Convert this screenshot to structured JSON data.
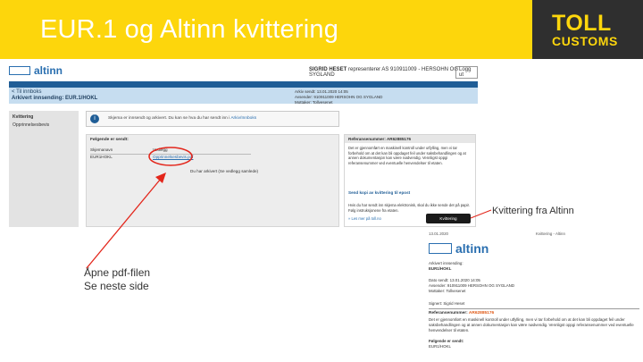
{
  "slide": {
    "title": "EUR.1 og Altinn kvittering",
    "logo_line1": "TOLL",
    "logo_line2": "CUSTOMS",
    "caption_right": "Kvittering fra Altinn",
    "caption_left_line1": "Åpne pdf-filen",
    "caption_left_line2": "Se neste side",
    "colors": {
      "header_bg": "#fdd60c",
      "logo_bg": "#2f2f2f",
      "altinn_blue": "#1f5d96",
      "callout": "#e3261b"
    }
  },
  "altinn": {
    "brand": "altinn",
    "user_label": "SIGRID HESET",
    "user_prefix": "representerer",
    "user_org": "AS 910911009 - HERSOHN OG SYGLAND",
    "logout_label": "Logg ut",
    "back_label": "< Til innboks",
    "message_title": "Arkivert innsending: EUR.1/HOKL",
    "meta_line1": "Arkiv sendt: 13.01.2020 14:05",
    "meta_line2": "Avsender: 910911009 HERSOHN OG SYGLAND",
    "meta_line3": "Mottaker: Tollvesenet",
    "sidebar_items": [
      "Kvittering",
      "Opprinnelsesbevis"
    ],
    "info_text": "Skjema er innsendt og arkivert. Du kan se hva du har sendt inn i",
    "info_link": "Arkiv/Innboks",
    "attachments_heading": "Følgende er sendt:",
    "attachments_header": [
      "Skjemanavn",
      "Vedlegg"
    ],
    "attachment_rows": [
      {
        "name": "EUR1HOKL",
        "file": "Opprinnelsesbevis.pdf"
      }
    ],
    "attachment_note": "Du har arkivert (Se vedlegg samlede)",
    "receipt_heading": "Referansenummer: AR62885176",
    "receipt_text": "Det er gjennomført en maskinell kontroll under utfylling, men vi tar forbehold om at det kan bli oppdaget feil under saksbehandlingen og at annen dokumentasjon kan være nødvendig. Vennligst oppgi referansenummer ved eventuelle henvendelser til etaten.",
    "receipt_link": "Send kopi av kvittering til epost",
    "receipt_text2": "Hvis du har sendt inn skjema elektronisk, skal du ikke sende det på papir. Følg instruksjonene fra etaten.",
    "receipt_link2": "» Les mer på toll.no",
    "kvittering_button": "Kvittering"
  },
  "pdf": {
    "date": "13.01.2020",
    "top_right": "Kvittering - Altinn",
    "brand": "altinn",
    "archived_label": "Arkivert innsending:",
    "archived_value": "EUR1/HOKL",
    "line_date": "Dato sendt: 13.01.2020 14:05",
    "line_sender": "Avsender: 910911009 HERSOHN OG SYGLAND",
    "line_receiver": "Mottaker: Tollvesenet",
    "line_sign": "Signert: Sigrid Heset",
    "ref_label": "Referansenummer:",
    "ref_value": "AR62885176",
    "ref_text": "Det er gjennomført en maskinell kontroll under utfylling, men vi tar forbehold om at det kan bli oppdaget feil under saksbehandlingen og at annen dokumentasjon kan være nødvendig. Vennligst oppgi referansenummer ved eventuelle henvendelser til etaten.",
    "sent_label": "Følgende er sendt:",
    "sent_value": "EUR1/HOKL"
  }
}
